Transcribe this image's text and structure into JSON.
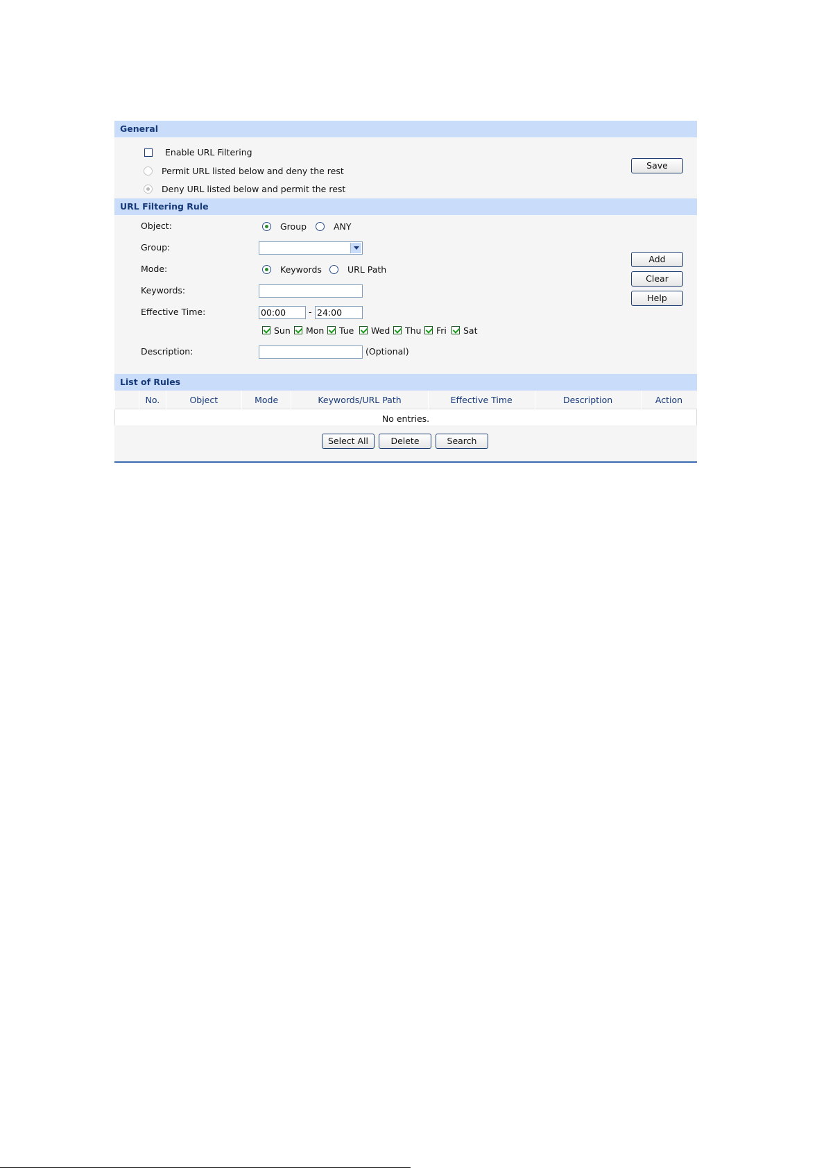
{
  "general": {
    "title": "General",
    "enable_label": "Enable URL Filtering",
    "enable_checked": false,
    "permit_label": "Permit URL listed below and deny the rest",
    "deny_label": "Deny URL listed below and permit the rest",
    "selected_policy": "deny",
    "save_label": "Save"
  },
  "rule": {
    "title": "URL Filtering Rule",
    "object_label": "Object:",
    "object_options": [
      "Group",
      "ANY"
    ],
    "object_selected": "Group",
    "group_label": "Group:",
    "group_value": "",
    "mode_label": "Mode:",
    "mode_options": [
      "Keywords",
      "URL Path"
    ],
    "mode_selected": "Keywords",
    "keywords_label": "Keywords:",
    "keywords_value": "",
    "effective_time_label": "Effective Time:",
    "time_start": "00:00",
    "time_separator": "-",
    "time_end": "24:00",
    "days": [
      {
        "label": "Sun",
        "checked": true
      },
      {
        "label": "Mon",
        "checked": true
      },
      {
        "label": "Tue",
        "checked": true
      },
      {
        "label": "Wed",
        "checked": true
      },
      {
        "label": "Thu",
        "checked": true
      },
      {
        "label": "Fri",
        "checked": true
      },
      {
        "label": "Sat",
        "checked": true
      }
    ],
    "description_label": "Description:",
    "description_value": "",
    "optional_hint": "(Optional)",
    "add_label": "Add",
    "clear_label": "Clear",
    "help_label": "Help"
  },
  "rules_list": {
    "title": "List of Rules",
    "columns": [
      "No.",
      "Object",
      "Mode",
      "Keywords/URL Path",
      "Effective Time",
      "Description",
      "Action"
    ],
    "empty_text": "No entries.",
    "select_all_label": "Select All",
    "delete_label": "Delete",
    "search_label": "Search"
  },
  "colors": {
    "section_header_bg": "#c9dcf9",
    "section_header_text": "#173a7a",
    "body_bg": "#f5f5f5",
    "bottom_rule": "#3a6bb0",
    "check_green": "#1a9a1a"
  }
}
